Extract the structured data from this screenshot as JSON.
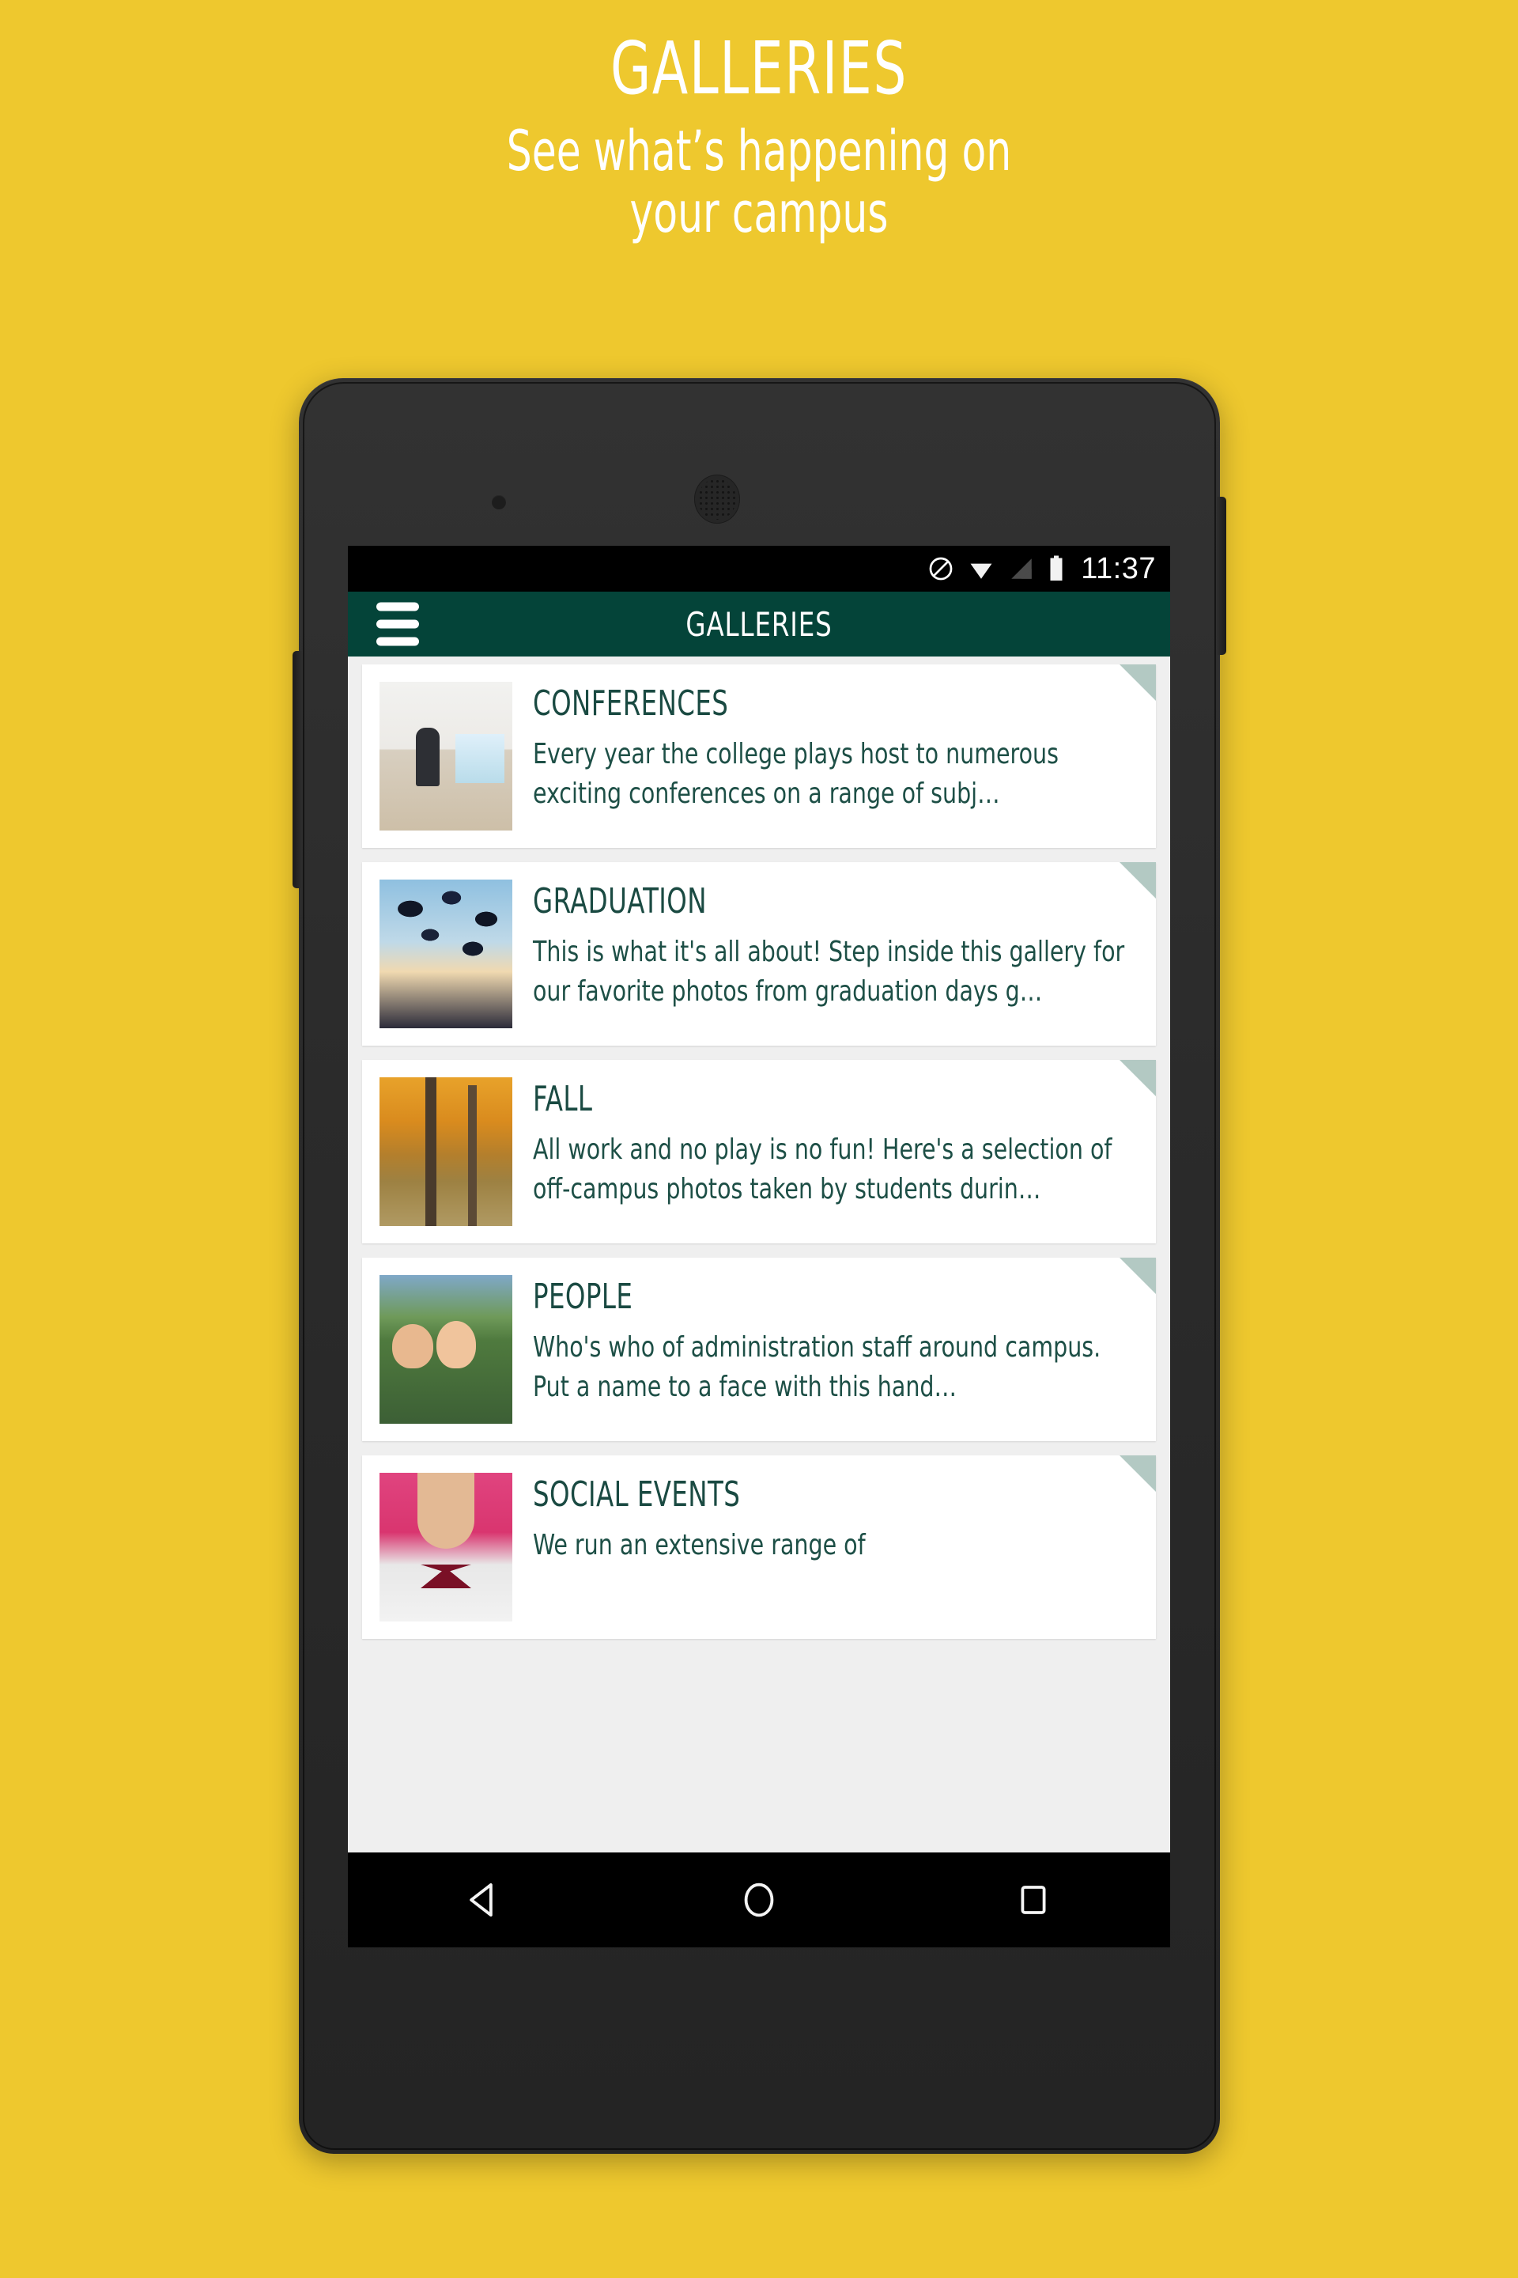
{
  "promo": {
    "title": "GALLERIES",
    "subtitle": "See what’s happening on\nyour campus"
  },
  "status_bar": {
    "time": "11:37",
    "icons": [
      "do-not-disturb-icon",
      "wifi-icon",
      "cell-signal-icon",
      "battery-icon"
    ]
  },
  "app_bar": {
    "title": "GALLERIES",
    "menu_icon": "hamburger-menu-icon",
    "background_color": "#044439"
  },
  "colors": {
    "page_background": "#eec82e",
    "app_bar": "#044439",
    "card_title": "#1a4a42",
    "card_text": "#1d4f46",
    "corner_ribbon": "#b3c9c3",
    "list_background": "#efefef"
  },
  "galleries": [
    {
      "title": "CONFERENCES",
      "description": "Every year the college plays host to numerous exciting conferences on a range of subj…",
      "thumb": "conference-speaker-photo"
    },
    {
      "title": "GRADUATION",
      "description": "This is what it's all about!  Step inside this gallery for our favorite photos from graduation days g…",
      "thumb": "graduation-caps-photo"
    },
    {
      "title": "FALL",
      "description": "All work and no play is no fun! Here's a selection of off-campus photos taken by students durin…",
      "thumb": "autumn-trees-photo"
    },
    {
      "title": "PEOPLE",
      "description": "Who's who of administration staff around campus.  Put a name to a face with this hand…",
      "thumb": "students-laptop-photo"
    },
    {
      "title": "SOCIAL EVENTS",
      "description": "We run an extensive range of",
      "thumb": "bowtie-man-photo"
    }
  ],
  "nav_bar": {
    "back": "back-icon",
    "home": "home-icon",
    "recents": "recents-icon"
  }
}
